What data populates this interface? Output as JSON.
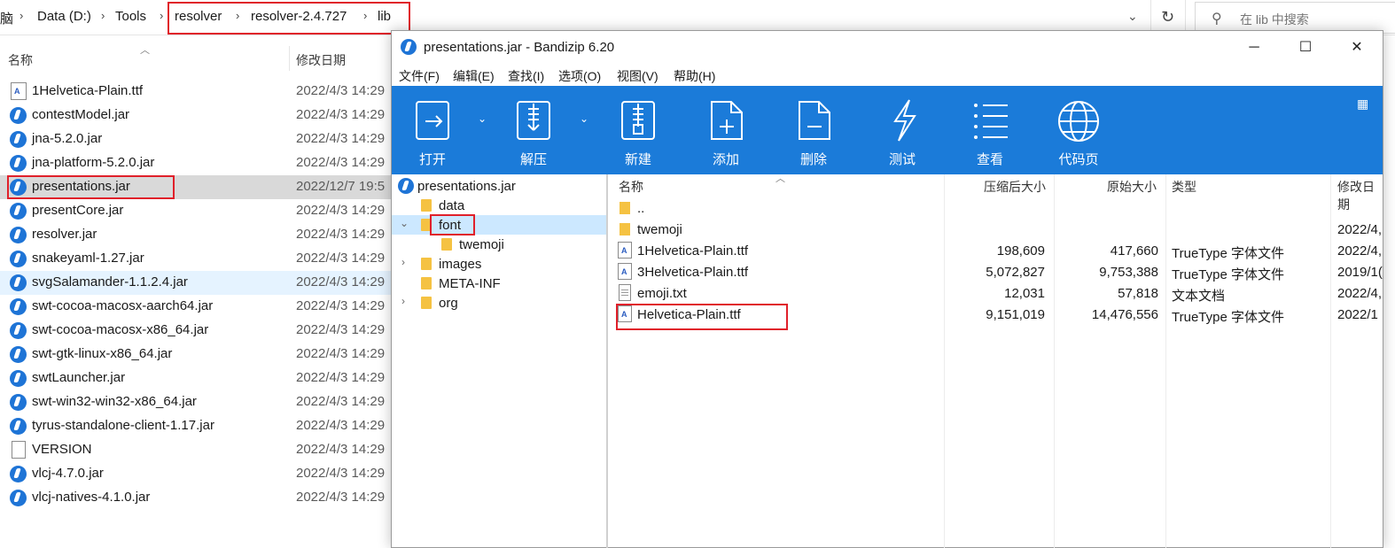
{
  "explorer": {
    "breadcrumb": [
      "脑",
      "Data (D:)",
      "Tools",
      "resolver",
      "resolver-2.4.727",
      "lib"
    ],
    "search_placeholder": "在 lib 中搜索",
    "columns": {
      "name": "名称",
      "date": "修改日期"
    },
    "files": [
      {
        "name": "1Helvetica-Plain.ttf",
        "date": "2022/4/3 14:29",
        "icon": "font-file-icon"
      },
      {
        "name": "contestModel.jar",
        "date": "2022/4/3 14:29",
        "icon": "jar-icon"
      },
      {
        "name": "jna-5.2.0.jar",
        "date": "2022/4/3 14:29",
        "icon": "jar-icon"
      },
      {
        "name": "jna-platform-5.2.0.jar",
        "date": "2022/4/3 14:29",
        "icon": "jar-icon"
      },
      {
        "name": "presentations.jar",
        "date": "2022/12/7 19:5",
        "icon": "jar-icon"
      },
      {
        "name": "presentCore.jar",
        "date": "2022/4/3 14:29",
        "icon": "jar-icon"
      },
      {
        "name": "resolver.jar",
        "date": "2022/4/3 14:29",
        "icon": "jar-icon"
      },
      {
        "name": "snakeyaml-1.27.jar",
        "date": "2022/4/3 14:29",
        "icon": "jar-icon"
      },
      {
        "name": "svgSalamander-1.1.2.4.jar",
        "date": "2022/4/3 14:29",
        "icon": "jar-icon"
      },
      {
        "name": "swt-cocoa-macosx-aarch64.jar",
        "date": "2022/4/3 14:29",
        "icon": "jar-icon"
      },
      {
        "name": "swt-cocoa-macosx-x86_64.jar",
        "date": "2022/4/3 14:29",
        "icon": "jar-icon"
      },
      {
        "name": "swt-gtk-linux-x86_64.jar",
        "date": "2022/4/3 14:29",
        "icon": "jar-icon"
      },
      {
        "name": "swtLauncher.jar",
        "date": "2022/4/3 14:29",
        "icon": "jar-icon"
      },
      {
        "name": "swt-win32-win32-x86_64.jar",
        "date": "2022/4/3 14:29",
        "icon": "jar-icon"
      },
      {
        "name": "tyrus-standalone-client-1.17.jar",
        "date": "2022/4/3 14:29",
        "icon": "jar-icon"
      },
      {
        "name": "VERSION",
        "date": "2022/4/3 14:29",
        "icon": "file-icon"
      },
      {
        "name": "vlcj-4.7.0.jar",
        "date": "2022/4/3 14:29",
        "icon": "jar-icon"
      },
      {
        "name": "vlcj-natives-4.1.0.jar",
        "date": "2022/4/3 14:29",
        "icon": "jar-icon"
      }
    ]
  },
  "bandizip": {
    "title": "presentations.jar - Bandizip 6.20",
    "menu": [
      "文件(F)",
      "编辑(E)",
      "查找(I)",
      "选项(O)",
      "视图(V)",
      "帮助(H)"
    ],
    "toolbar": [
      "打开",
      "解压",
      "新建",
      "添加",
      "删除",
      "测试",
      "查看",
      "代码页"
    ],
    "tree": {
      "root": "presentations.jar",
      "items": [
        "data",
        "font",
        "twemoji",
        "images",
        "META-INF",
        "org"
      ]
    },
    "columns": {
      "name": "名称",
      "compressed": "压缩后大小",
      "original": "原始大小",
      "type": "类型",
      "modified": "修改日期"
    },
    "rows": [
      {
        "name": "..",
        "compressed": "",
        "original": "",
        "type": "",
        "modified": ""
      },
      {
        "name": "twemoji",
        "compressed": "",
        "original": "",
        "type": "",
        "modified": "2022/4,"
      },
      {
        "name": "1Helvetica-Plain.ttf",
        "compressed": "198,609",
        "original": "417,660",
        "type": "TrueType 字体文件",
        "modified": "2022/4,"
      },
      {
        "name": "3Helvetica-Plain.ttf",
        "compressed": "5,072,827",
        "original": "9,753,388",
        "type": "TrueType 字体文件",
        "modified": "2019/1("
      },
      {
        "name": "emoji.txt",
        "compressed": "12,031",
        "original": "57,818",
        "type": "文本文档",
        "modified": "2022/4,"
      },
      {
        "name": "Helvetica-Plain.ttf",
        "compressed": "9,151,019",
        "original": "14,476,556",
        "type": "TrueType 字体文件",
        "modified": "2022/1"
      }
    ]
  }
}
